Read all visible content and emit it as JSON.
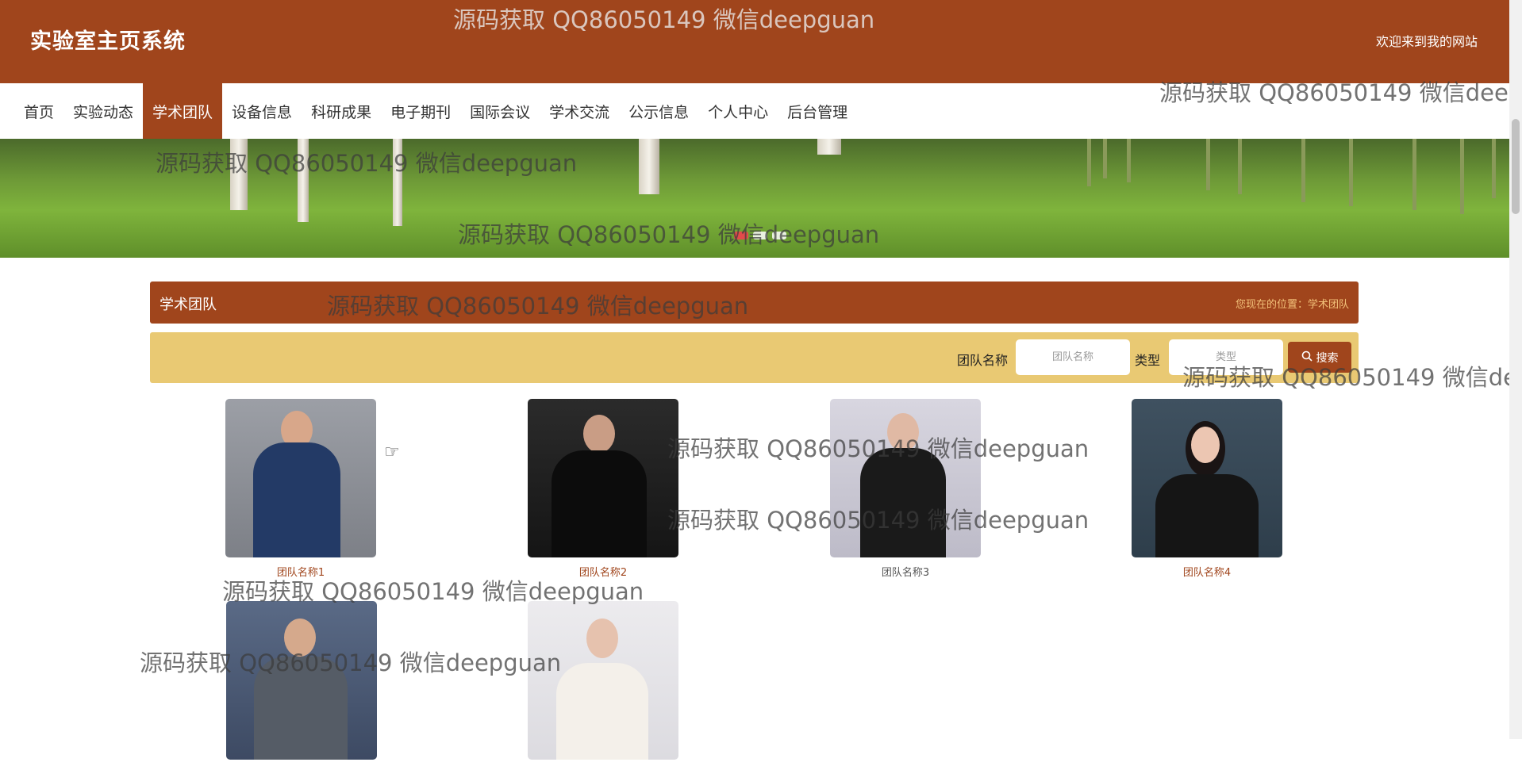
{
  "header": {
    "site_title": "实验室主页系统",
    "welcome": "欢迎来到我的网站"
  },
  "nav": {
    "items": [
      {
        "label": "首页"
      },
      {
        "label": "实验动态"
      },
      {
        "label": "学术团队",
        "active": true
      },
      {
        "label": "设备信息"
      },
      {
        "label": "科研成果"
      },
      {
        "label": "电子期刊"
      },
      {
        "label": "国际会议"
      },
      {
        "label": "学术交流"
      },
      {
        "label": "公示信息"
      },
      {
        "label": "个人中心"
      },
      {
        "label": "后台管理"
      }
    ]
  },
  "section": {
    "title": "学术团队",
    "breadcrumb": "您现在的位置：学术团队"
  },
  "search": {
    "team_label": "团队名称",
    "team_placeholder": "团队名称",
    "type_label": "类型",
    "type_placeholder": "类型",
    "button_label": "搜索"
  },
  "teams": [
    {
      "name": "团队名称1"
    },
    {
      "name": "团队名称2"
    },
    {
      "name": "团队名称3"
    },
    {
      "name": "团队名称4"
    },
    {
      "name": ""
    },
    {
      "name": ""
    }
  ],
  "watermark_text": "源码获取 QQ86050149 微信deepguan",
  "colors": {
    "brand": "#a0451c",
    "search_bar": "#e9c973",
    "breadcrumb": "#f3c27a"
  }
}
